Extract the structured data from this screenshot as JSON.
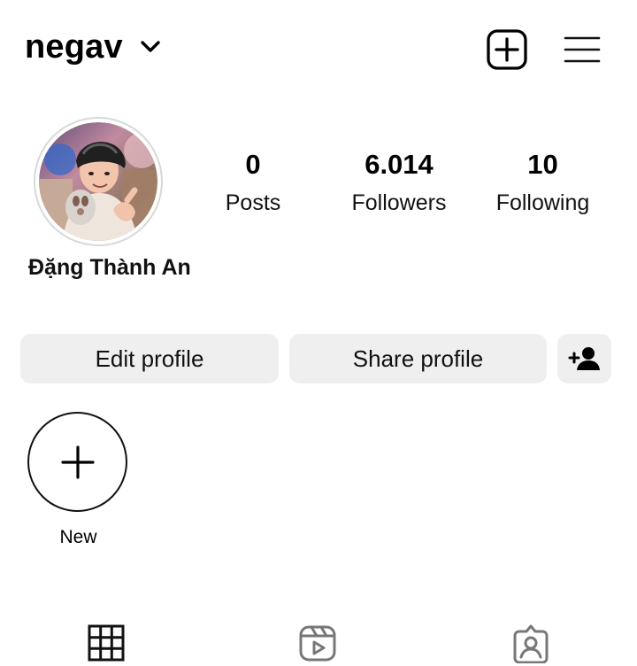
{
  "header": {
    "username": "negav",
    "icons": {
      "switch_account": "chevron-down-icon",
      "create": "plus-square-icon",
      "menu": "hamburger-menu-icon"
    }
  },
  "profile": {
    "display_name": "Đặng Thành An",
    "avatar": "profile-avatar-image"
  },
  "stats": [
    {
      "value": "0",
      "label": "Posts"
    },
    {
      "value": "6.014",
      "label": "Followers"
    },
    {
      "value": "10",
      "label": "Following"
    }
  ],
  "actions": {
    "edit_profile": "Edit profile",
    "share_profile": "Share profile",
    "discover_people_icon": "add-person-icon"
  },
  "highlights": {
    "new_label": "New",
    "new_icon": "plus-icon"
  },
  "tabs": [
    {
      "name": "grid",
      "icon": "grid-icon"
    },
    {
      "name": "reels",
      "icon": "reels-icon"
    },
    {
      "name": "tagged",
      "icon": "tagged-person-icon"
    }
  ],
  "colors": {
    "background": "#ffffff",
    "text": "#000000",
    "button_background": "#efefef",
    "avatar_ring": "#d8d8d8"
  }
}
